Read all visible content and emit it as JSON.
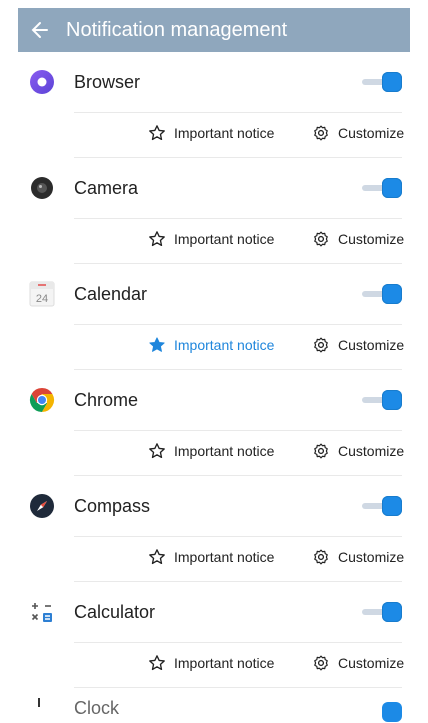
{
  "header": {
    "title": "Notification management"
  },
  "apps": [
    {
      "name": "Browser",
      "icon": "browser-icon",
      "enabled": true,
      "important_label": "Important notice",
      "important": false,
      "customize_label": "Customize"
    },
    {
      "name": "Camera",
      "icon": "camera-icon",
      "enabled": true,
      "important_label": "Important notice",
      "important": false,
      "customize_label": "Customize"
    },
    {
      "name": "Calendar",
      "icon": "calendar-icon",
      "enabled": true,
      "important_label": "Important notice",
      "important": true,
      "customize_label": "Customize"
    },
    {
      "name": "Chrome",
      "icon": "chrome-icon",
      "enabled": true,
      "important_label": "Important notice",
      "important": false,
      "customize_label": "Customize"
    },
    {
      "name": "Compass",
      "icon": "compass-icon",
      "enabled": true,
      "important_label": "Important notice",
      "important": false,
      "customize_label": "Customize"
    },
    {
      "name": "Calculator",
      "icon": "calculator-icon",
      "enabled": true,
      "important_label": "Important notice",
      "important": false,
      "customize_label": "Customize"
    }
  ],
  "peek": {
    "name": "Clock"
  },
  "colors": {
    "header": "#8fa7bd",
    "accent": "#1c8ae6"
  }
}
